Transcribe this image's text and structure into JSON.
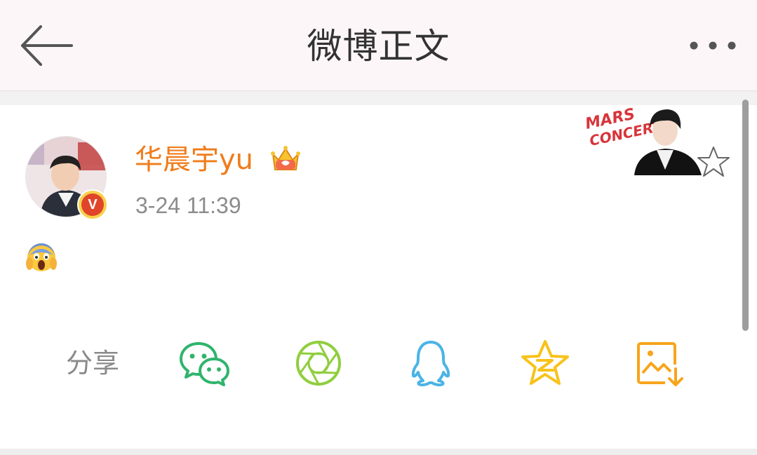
{
  "header": {
    "title": "微博正文",
    "back_icon": "arrow-left-icon",
    "more_icon": "more-dots-icon"
  },
  "post": {
    "author": "华晨宇yu",
    "timestamp": "3-24 11:39",
    "verified_badge": "V",
    "content_emoji": "screaming-face-emoji",
    "sticker_text": "MARS CONCERT"
  },
  "share": {
    "label": "分享",
    "targets": [
      {
        "name": "wechat-icon",
        "color": "#2fb46c"
      },
      {
        "name": "moments-icon",
        "color": "#8fce3e"
      },
      {
        "name": "qq-icon",
        "color": "#4bb4e6"
      },
      {
        "name": "qzone-icon",
        "color": "#f8c21a"
      },
      {
        "name": "save-image-icon",
        "color": "#f7a51c"
      }
    ]
  },
  "colors": {
    "username": "#f07c1b",
    "badge": "#e0452a",
    "header_bg": "#fdf6f9"
  }
}
